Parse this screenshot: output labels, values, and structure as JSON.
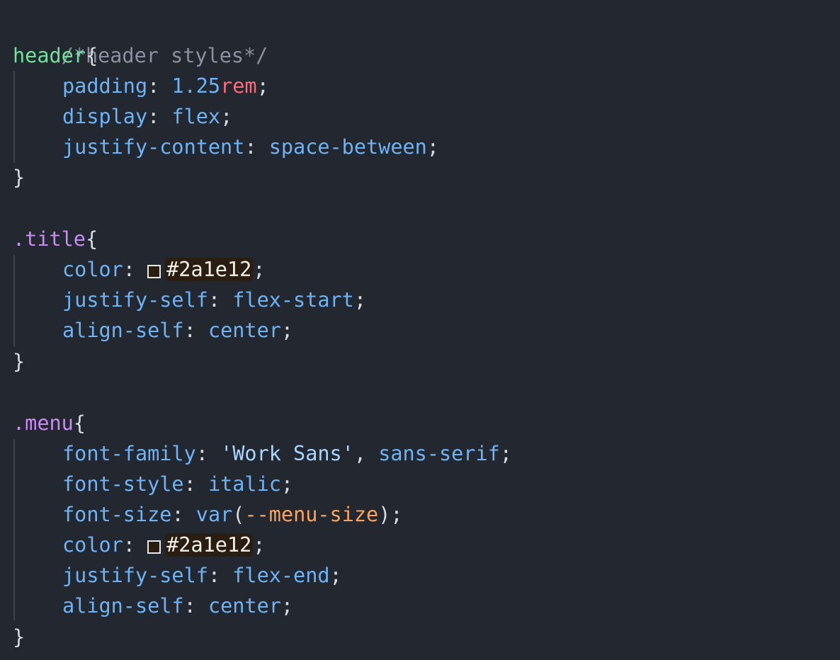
{
  "editor": {
    "language": "css",
    "colors": {
      "background": "#23272f",
      "selector": "#6ee39b",
      "class_selector": "#c98cf5",
      "property": "#6cb4f7",
      "unit": "#ff6b7d",
      "variable": "#ffa25a",
      "comment": "#8a919e",
      "swatch_color": "#2a1e12"
    },
    "lines": {
      "l1": {
        "comment": "/*header styles*/"
      },
      "l2": {
        "selector": "header",
        "open": "{"
      },
      "l3": {
        "prop": "padding",
        "colon": ":",
        "num": "1.25",
        "unit": "rem",
        "semi": ";"
      },
      "l4": {
        "prop": "display",
        "colon": ":",
        "value": "flex",
        "semi": ";"
      },
      "l5": {
        "prop": "justify-content",
        "colon": ":",
        "value": "space-between",
        "semi": ";"
      },
      "l6": {
        "close": "}"
      },
      "l8": {
        "selector": ".title",
        "open": "{"
      },
      "l9": {
        "prop": "color",
        "colon": ":",
        "hex": "#2a1e12",
        "semi": ";"
      },
      "l10": {
        "prop": "justify-self",
        "colon": ":",
        "value": "flex-start",
        "semi": ";"
      },
      "l11": {
        "prop": "align-self",
        "colon": ":",
        "value": "center",
        "semi": ";"
      },
      "l12": {
        "close": "}"
      },
      "l14": {
        "selector": ".menu",
        "open": "{"
      },
      "l15": {
        "prop": "font-family",
        "colon": ":",
        "string": "'Work Sans'",
        "comma": ",",
        "value": "sans-serif",
        "semi": ";"
      },
      "l16": {
        "prop": "font-style",
        "colon": ":",
        "value": "italic",
        "semi": ";"
      },
      "l17": {
        "prop": "font-size",
        "colon": ":",
        "fn": "var",
        "paren_open": "(",
        "var": "--menu-size",
        "paren_close": ")",
        "semi": ";"
      },
      "l18": {
        "prop": "color",
        "colon": ":",
        "hex": "#2a1e12",
        "semi": ";"
      },
      "l19": {
        "prop": "justify-self",
        "colon": ":",
        "value": "flex-end",
        "semi": ";"
      },
      "l20": {
        "prop": "align-self",
        "colon": ":",
        "value": "center",
        "semi": ";"
      },
      "l21": {
        "close": "}"
      }
    }
  }
}
